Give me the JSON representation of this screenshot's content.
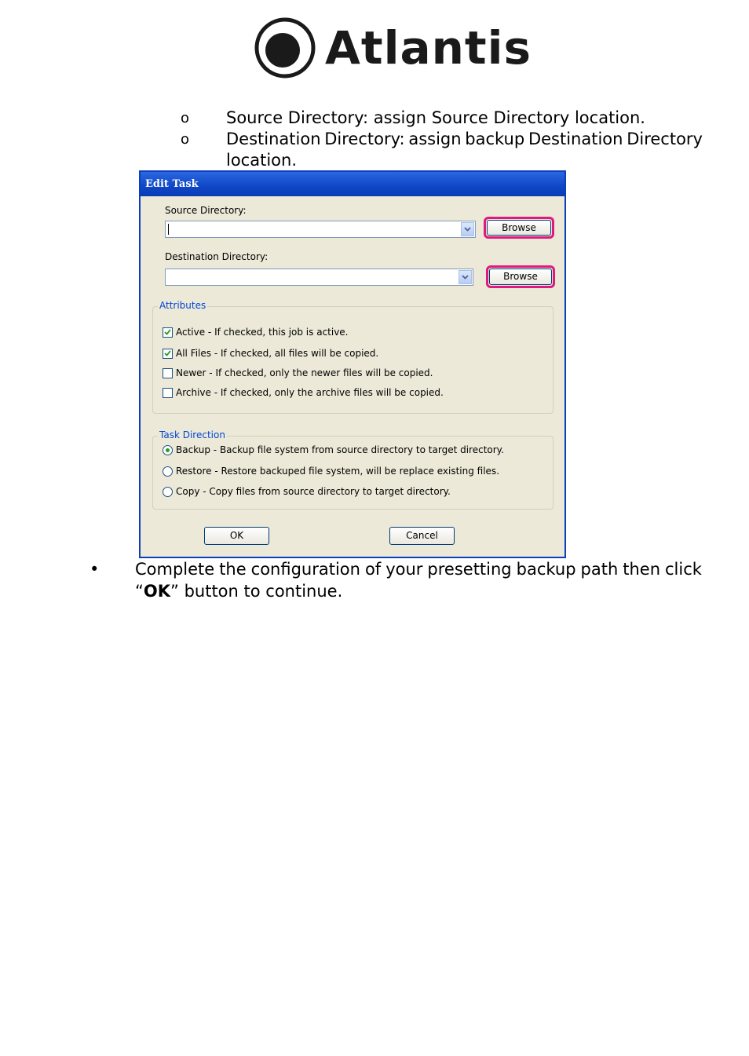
{
  "logo": {
    "text": "Atlantis"
  },
  "sub_bullets": [
    {
      "marker": "o",
      "text": "Source Directory: assign Source Directory location."
    },
    {
      "marker": "o",
      "line1": [
        "Destination",
        "Directory:",
        "assign",
        "backup",
        "Destination",
        "Directory"
      ],
      "line2": "location."
    }
  ],
  "dialog": {
    "title": "Edit Task",
    "source_label": "Source Directory:",
    "source_value": "",
    "dest_label": "Destination Directory:",
    "dest_value": "",
    "browse_label": "Browse",
    "attributes_legend": "Attributes",
    "attributes": [
      {
        "label": "Active - If checked, this job is active.",
        "checked": true
      },
      {
        "label": "All Files - If checked, all files will be copied.",
        "checked": true
      },
      {
        "label": "Newer - If checked, only the newer files will be copied.",
        "checked": false
      },
      {
        "label": "Archive - If checked, only the archive files will be copied.",
        "checked": false
      }
    ],
    "direction_legend": "Task Direction",
    "directions": [
      {
        "label": "Backup - Backup file system from source directory to target directory.",
        "selected": true
      },
      {
        "label": "Restore - Restore backuped file system, will be replace existing files.",
        "selected": false
      },
      {
        "label": "Copy - Copy files from source directory to target directory.",
        "selected": false
      }
    ],
    "ok_label": "OK",
    "cancel_label": "Cancel",
    "highlight_color": "#e0197e"
  },
  "main_bullet": {
    "marker": "•",
    "line1": [
      "Complete",
      "the",
      "configuration",
      "of",
      "your",
      "presetting",
      "backup",
      "path",
      "then",
      "click"
    ],
    "quote_open": "“",
    "bold": "OK",
    "quote_close_rest": "” button to continue."
  }
}
